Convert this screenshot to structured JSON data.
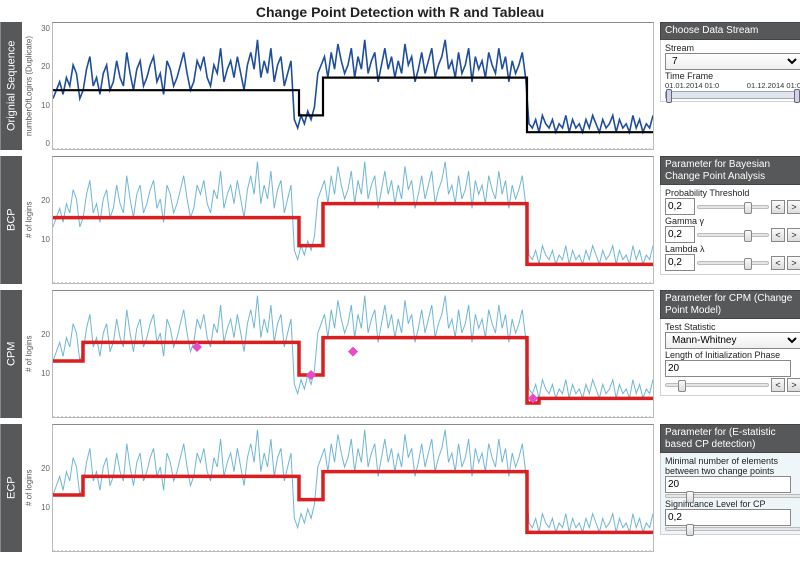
{
  "title": "Change Point Detection with R and Tableau",
  "panels": [
    {
      "label": "Orignial Sequence",
      "ylabel": "numberOfLogins (Duplicate)",
      "yticks": [
        "30",
        "20",
        "10",
        "0"
      ]
    },
    {
      "label": "BCP",
      "ylabel": "# of logins",
      "yticks": [
        "20",
        "10"
      ]
    },
    {
      "label": "CPM",
      "ylabel": "# of logins",
      "yticks": [
        "20",
        "10"
      ]
    },
    {
      "label": "ECP",
      "ylabel": "# of logins",
      "yticks": [
        "20",
        "10"
      ]
    }
  ],
  "side": {
    "stream": {
      "hdr": "Choose Data Stream",
      "stream_label": "Stream",
      "stream_value": "7",
      "timeframe_label": "Time Frame",
      "tf_from": "01.01.2014 01:0",
      "tf_to": "01.12.2014 01:0"
    },
    "bcp": {
      "hdr": "Parameter for Bayesian Change Point Analysis",
      "prob_label": "Probability Threshold",
      "prob_value": "0,2",
      "gamma_label": "Gamma  γ",
      "gamma_value": "0,2",
      "lambda_label": "Lambda λ",
      "lambda_value": "0,2"
    },
    "cpm": {
      "hdr": "Parameter for CPM (Change Point Model)",
      "test_label": "Test Statistic",
      "test_value": "Mann-Whitney",
      "init_label": "Length of Initialization Phase",
      "init_value": "20"
    },
    "ecp": {
      "hdr": "Parameter for (E-statistic based CP detection)",
      "min_label": "Minimal number of elements between two change points",
      "min_value": "20",
      "sig_label": "Significance Level for CP",
      "sig_value": "0,2"
    }
  },
  "chart_data": [
    {
      "type": "line",
      "title": "Orignial Sequence",
      "ylabel": "numberOfLogins (Duplicate)",
      "ylim": [
        0,
        30
      ],
      "series": [
        {
          "name": "numberOfLogins",
          "color": "#1f4e9c",
          "values": [
            12,
            14,
            16,
            13,
            17,
            15,
            20,
            18,
            12,
            14,
            19,
            22,
            15,
            17,
            13,
            18,
            20,
            14,
            16,
            21,
            17,
            15,
            23,
            18,
            14,
            19,
            21,
            15,
            17,
            20,
            22,
            16,
            18,
            13,
            21,
            19,
            15,
            17,
            20,
            23,
            18,
            14,
            16,
            21,
            19,
            22,
            17,
            15,
            20,
            18,
            24,
            16,
            19,
            21,
            17,
            22,
            18,
            14,
            20,
            23,
            19,
            26,
            17,
            21,
            18,
            24,
            16,
            20,
            22,
            15,
            18,
            21,
            7,
            5,
            8,
            6,
            9,
            7,
            10,
            18,
            20,
            22,
            17,
            23,
            19,
            25,
            21,
            18,
            20,
            24,
            17,
            22,
            19,
            26,
            18,
            21,
            23,
            16,
            20,
            24,
            19,
            22,
            17,
            21,
            18,
            25,
            20,
            22,
            16,
            19,
            23,
            18,
            21,
            24,
            17,
            20,
            22,
            26,
            19,
            21,
            17,
            23,
            18,
            20,
            24,
            16,
            22,
            19,
            21,
            17,
            23,
            20,
            18,
            24,
            19,
            22,
            16,
            21,
            18,
            20,
            23,
            17,
            6,
            5,
            7,
            4,
            8,
            6,
            5,
            7,
            4,
            6,
            5,
            8,
            4,
            7,
            5,
            6,
            4,
            7,
            5,
            8,
            6,
            4,
            7,
            5,
            6,
            8,
            4,
            7,
            5,
            6,
            4,
            8,
            5,
            7,
            4,
            6,
            5,
            8
          ]
        },
        {
          "name": "mean-level",
          "color": "#000000",
          "style": "step",
          "segments": [
            {
              "x_end_frac": 0.41,
              "level": 14
            },
            {
              "x_end_frac": 0.45,
              "level": 8
            },
            {
              "x_end_frac": 0.79,
              "level": 17
            },
            {
              "x_end_frac": 1.0,
              "level": 4
            }
          ]
        }
      ]
    },
    {
      "type": "line",
      "title": "BCP",
      "ylabel": "# of logins",
      "ylim": [
        0,
        27
      ],
      "series": [
        {
          "name": "logins",
          "color": "#6fb6d6",
          "values": [
            12,
            14,
            16,
            13,
            17,
            15,
            20,
            18,
            12,
            14,
            19,
            22,
            15,
            17,
            13,
            18,
            20,
            14,
            16,
            21,
            17,
            15,
            23,
            18,
            14,
            19,
            21,
            15,
            17,
            20,
            22,
            16,
            18,
            13,
            21,
            19,
            15,
            17,
            20,
            23,
            18,
            14,
            16,
            21,
            19,
            22,
            17,
            15,
            20,
            18,
            24,
            16,
            19,
            21,
            17,
            22,
            18,
            14,
            20,
            23,
            19,
            26,
            17,
            21,
            18,
            24,
            16,
            20,
            22,
            15,
            18,
            21,
            7,
            5,
            8,
            6,
            9,
            7,
            10,
            18,
            20,
            22,
            17,
            23,
            19,
            25,
            21,
            18,
            20,
            24,
            17,
            22,
            19,
            26,
            18,
            21,
            23,
            16,
            20,
            24,
            19,
            22,
            17,
            21,
            18,
            25,
            20,
            22,
            16,
            19,
            23,
            18,
            21,
            24,
            17,
            20,
            22,
            26,
            19,
            21,
            17,
            23,
            18,
            20,
            24,
            16,
            22,
            19,
            21,
            17,
            23,
            20,
            18,
            24,
            19,
            22,
            16,
            21,
            18,
            20,
            23,
            17,
            6,
            5,
            7,
            4,
            8,
            6,
            5,
            7,
            4,
            6,
            5,
            8,
            4,
            7,
            5,
            6,
            4,
            7,
            5,
            8,
            6,
            4,
            7,
            5,
            6,
            8,
            4,
            7,
            5,
            6,
            4,
            8,
            5,
            7,
            4,
            6,
            5,
            8
          ]
        },
        {
          "name": "bcp-mean",
          "color": "#d91f1f",
          "style": "step",
          "segments": [
            {
              "x_end_frac": 0.41,
              "level": 14
            },
            {
              "x_end_frac": 0.45,
              "level": 8
            },
            {
              "x_end_frac": 0.79,
              "level": 17
            },
            {
              "x_end_frac": 1.0,
              "level": 4
            }
          ]
        }
      ]
    },
    {
      "type": "line",
      "title": "CPM",
      "ylabel": "# of logins",
      "ylim": [
        0,
        27
      ],
      "series": [
        {
          "name": "logins",
          "color": "#6fb6d6",
          "values": [
            12,
            14,
            16,
            13,
            17,
            15,
            20,
            18,
            12,
            14,
            19,
            22,
            15,
            17,
            13,
            18,
            20,
            14,
            16,
            21,
            17,
            15,
            23,
            18,
            14,
            19,
            21,
            15,
            17,
            20,
            22,
            16,
            18,
            13,
            21,
            19,
            15,
            17,
            20,
            23,
            18,
            14,
            16,
            21,
            19,
            22,
            17,
            15,
            20,
            18,
            24,
            16,
            19,
            21,
            17,
            22,
            18,
            14,
            20,
            23,
            19,
            26,
            17,
            21,
            18,
            24,
            16,
            20,
            22,
            15,
            18,
            21,
            7,
            5,
            8,
            6,
            9,
            7,
            10,
            18,
            20,
            22,
            17,
            23,
            19,
            25,
            21,
            18,
            20,
            24,
            17,
            22,
            19,
            26,
            18,
            21,
            23,
            16,
            20,
            24,
            19,
            22,
            17,
            21,
            18,
            25,
            20,
            22,
            16,
            19,
            23,
            18,
            21,
            24,
            17,
            20,
            22,
            26,
            19,
            21,
            17,
            23,
            18,
            20,
            24,
            16,
            22,
            19,
            21,
            17,
            23,
            20,
            18,
            24,
            19,
            22,
            16,
            21,
            18,
            20,
            23,
            17,
            6,
            5,
            7,
            4,
            8,
            6,
            5,
            7,
            4,
            6,
            5,
            8,
            4,
            7,
            5,
            6,
            4,
            7,
            5,
            8,
            6,
            4,
            7,
            5,
            6,
            8,
            4,
            7,
            5,
            6,
            4,
            8,
            5,
            7,
            4,
            6,
            5,
            8
          ]
        },
        {
          "name": "cpm-mean",
          "color": "#d91f1f",
          "style": "step",
          "segments": [
            {
              "x_end_frac": 0.05,
              "level": 12
            },
            {
              "x_end_frac": 0.41,
              "level": 16
            },
            {
              "x_end_frac": 0.45,
              "level": 9
            },
            {
              "x_end_frac": 0.79,
              "level": 17
            },
            {
              "x_end_frac": 0.81,
              "level": 3
            },
            {
              "x_end_frac": 1.0,
              "level": 4
            }
          ]
        },
        {
          "name": "detected-change-points",
          "color": "#e64cc8",
          "style": "points",
          "points": [
            {
              "x_frac": 0.24,
              "y": 15
            },
            {
              "x_frac": 0.43,
              "y": 9
            },
            {
              "x_frac": 0.5,
              "y": 14
            },
            {
              "x_frac": 0.8,
              "y": 4
            }
          ]
        }
      ]
    },
    {
      "type": "line",
      "title": "ECP",
      "ylabel": "# of logins",
      "ylim": [
        0,
        27
      ],
      "series": [
        {
          "name": "logins",
          "color": "#6fb6d6",
          "values": [
            12,
            14,
            16,
            13,
            17,
            15,
            20,
            18,
            12,
            14,
            19,
            22,
            15,
            17,
            13,
            18,
            20,
            14,
            16,
            21,
            17,
            15,
            23,
            18,
            14,
            19,
            21,
            15,
            17,
            20,
            22,
            16,
            18,
            13,
            21,
            19,
            15,
            17,
            20,
            23,
            18,
            14,
            16,
            21,
            19,
            22,
            17,
            15,
            20,
            18,
            24,
            16,
            19,
            21,
            17,
            22,
            18,
            14,
            20,
            23,
            19,
            26,
            17,
            21,
            18,
            24,
            16,
            20,
            22,
            15,
            18,
            21,
            7,
            5,
            8,
            6,
            9,
            7,
            10,
            18,
            20,
            22,
            17,
            23,
            19,
            25,
            21,
            18,
            20,
            24,
            17,
            22,
            19,
            26,
            18,
            21,
            23,
            16,
            20,
            24,
            19,
            22,
            17,
            21,
            18,
            25,
            20,
            22,
            16,
            19,
            23,
            18,
            21,
            24,
            17,
            20,
            22,
            26,
            19,
            21,
            17,
            23,
            18,
            20,
            24,
            16,
            22,
            19,
            21,
            17,
            23,
            20,
            18,
            24,
            19,
            22,
            16,
            21,
            18,
            20,
            23,
            17,
            6,
            5,
            7,
            4,
            8,
            6,
            5,
            7,
            4,
            6,
            5,
            8,
            4,
            7,
            5,
            6,
            4,
            7,
            5,
            8,
            6,
            4,
            7,
            5,
            6,
            8,
            4,
            7,
            5,
            6,
            4,
            8,
            5,
            7,
            4,
            6,
            5,
            8
          ]
        },
        {
          "name": "ecp-mean",
          "color": "#d91f1f",
          "style": "step",
          "segments": [
            {
              "x_end_frac": 0.05,
              "level": 12
            },
            {
              "x_end_frac": 0.41,
              "level": 16
            },
            {
              "x_end_frac": 0.45,
              "level": 11
            },
            {
              "x_end_frac": 0.79,
              "level": 17
            },
            {
              "x_end_frac": 1.0,
              "level": 4
            }
          ]
        }
      ]
    }
  ]
}
